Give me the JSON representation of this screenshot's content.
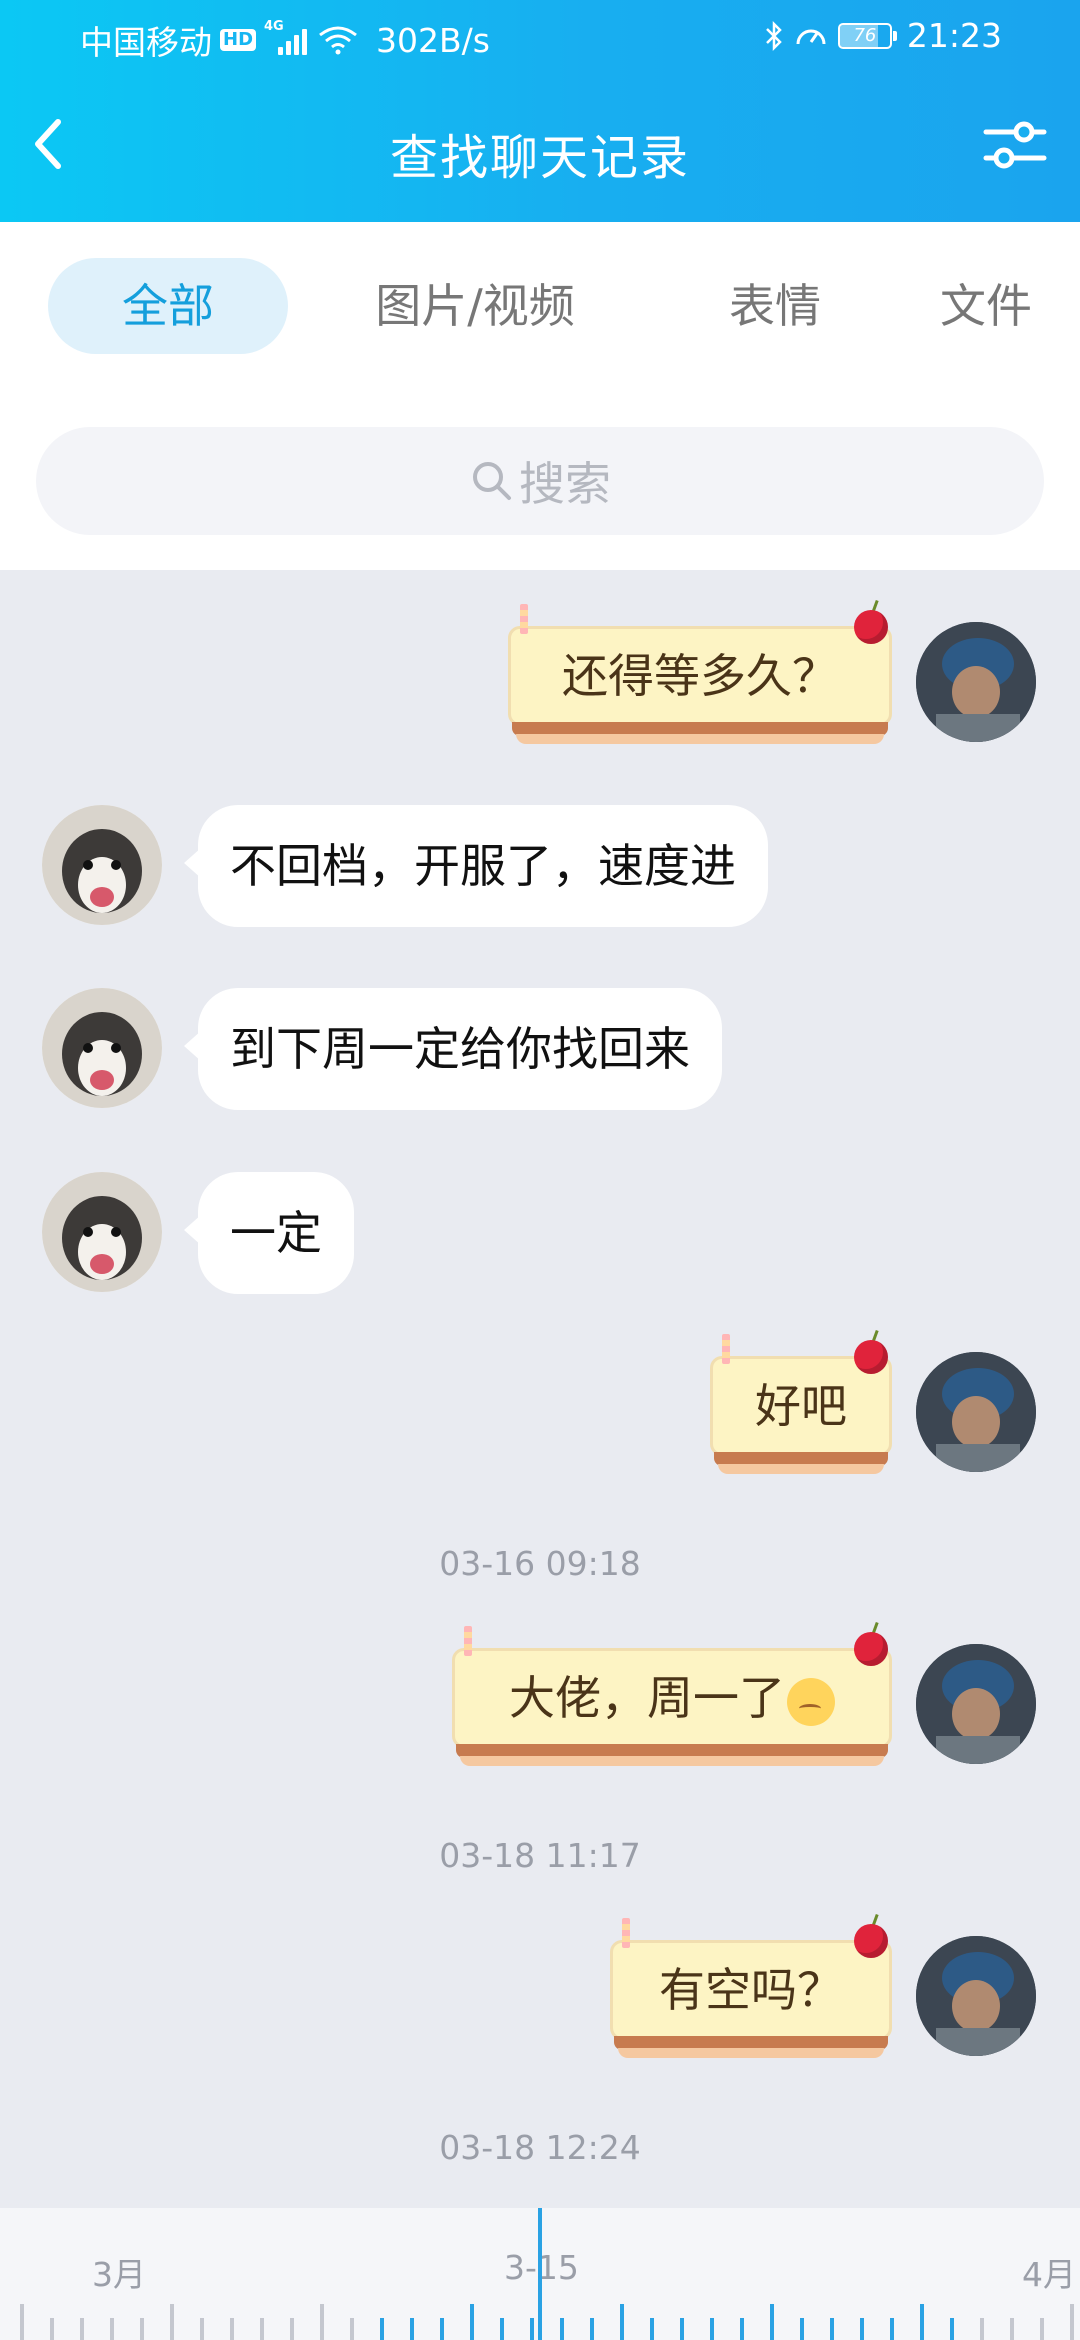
{
  "status_bar": {
    "carrier": "中国移动",
    "hd": "HD",
    "net_type": "4G",
    "speed": "302B/s",
    "battery": "76",
    "battery_level": 0.76,
    "time": "21:23"
  },
  "header": {
    "title": "查找聊天记录",
    "back_icon": "chevron-left-icon",
    "filter_icon": "sliders-icon"
  },
  "tabs": [
    {
      "label": "全部",
      "active": true
    },
    {
      "label": "图片/视频",
      "active": false
    },
    {
      "label": "表情",
      "active": false
    },
    {
      "label": "文件",
      "active": false
    }
  ],
  "search": {
    "placeholder": "搜索"
  },
  "messages": [
    {
      "side": "right",
      "text": "还得等多久？"
    },
    {
      "side": "left",
      "text": "不回档，开服了，速度进"
    },
    {
      "side": "left",
      "text": "到下周一定给你找回来"
    },
    {
      "side": "left",
      "text": "一定"
    },
    {
      "side": "right",
      "text": "好吧"
    },
    {
      "type": "time",
      "text": "03-16 09:18"
    },
    {
      "side": "right",
      "text": "大佬，周一了",
      "emoji": "sad-face-emoji"
    },
    {
      "type": "time",
      "text": "03-18 11:17"
    },
    {
      "side": "right",
      "text": "有空吗？"
    },
    {
      "type": "time",
      "text": "03-18 12:24"
    }
  ],
  "timeline": {
    "labels": [
      "3月",
      "3-15",
      "4月"
    ],
    "accent": "#2aa2e4"
  }
}
